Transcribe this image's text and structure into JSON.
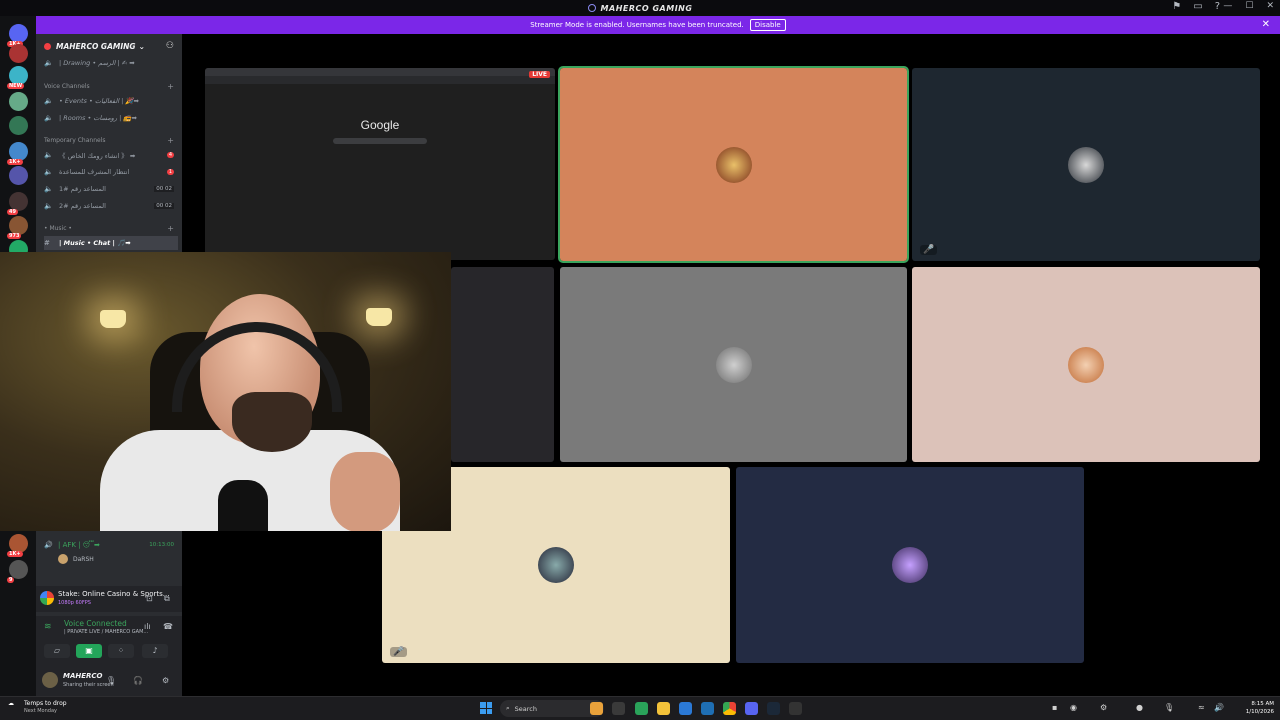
{
  "window": {
    "title": "MAHERCO GAMING"
  },
  "banner": {
    "message": "Streamer Mode is enabled. Usernames have been truncated.",
    "disable_label": "Disable"
  },
  "rail": {
    "badges": [
      "1K+",
      "NEW",
      "973",
      "1K+",
      "49",
      "9"
    ]
  },
  "sidebar": {
    "server_name": "MAHERCO GAMING",
    "channels": [
      {
        "label": "| Drawing • الرسم | ✍ ➡",
        "italic": true
      },
      {
        "label": "• Events • الفعاليات | 🎉➡",
        "italic": true
      },
      {
        "label": "| Rooms • رومسات | 📻➡",
        "italic": true
      },
      {
        "label": "《 انشاء رومك الخاص 》 ➡",
        "badge": "4"
      },
      {
        "label": "انتظار المشرف للمساعدة",
        "badge": "1"
      },
      {
        "label": "المساعد رقم #1",
        "time": "00 02"
      },
      {
        "label": "المساعد رقم #2",
        "time": "00 02"
      },
      {
        "label": "| Music • Chat | 🎵➡"
      }
    ],
    "categories": [
      "Voice Channels",
      "Temporary Channels",
      "• Music •"
    ],
    "afk": {
      "label": "| AFK | 😴➡",
      "time": "10:13:00",
      "user": "DaRSH"
    },
    "activity": {
      "title": "Stake: Online Casino & Sports...",
      "sub": "1080p 60FPS"
    },
    "voice": {
      "status": "Voice Connected",
      "channel": "| PRIVATE LIVE / MAHERCO GAM..."
    },
    "user": {
      "name": "MAHERCO",
      "status": "Sharing their screen"
    }
  },
  "stage": {
    "share": {
      "logo": "Google",
      "live": "LIVE"
    }
  },
  "taskbar": {
    "weather": "Temps to drop",
    "weather_sub": "Next Monday",
    "search": "Search",
    "time": "8:15 AM",
    "date": "1/10/2026"
  },
  "colors": {
    "accent": "#7b27e8",
    "green": "#3ba55d",
    "red": "#f23f43"
  }
}
